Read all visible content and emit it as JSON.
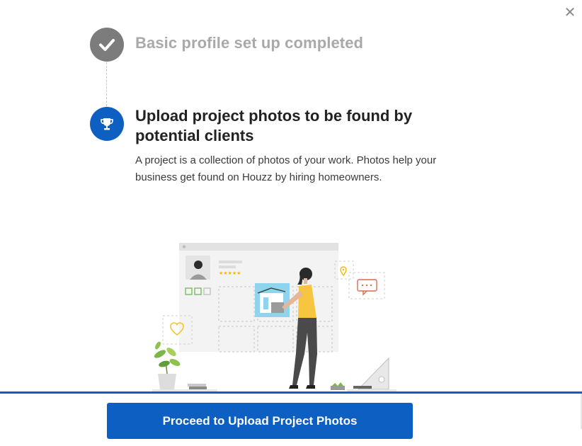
{
  "dialog": {
    "close_icon": "close-icon",
    "steps": [
      {
        "title": "Basic profile set up completed",
        "status": "completed",
        "icon": "checkmark-icon"
      },
      {
        "title": "Upload project photos to be found by potential clients",
        "description": "A project is a collection of photos of your work. Photos help your business get found on Houzz by hiring homeowners.",
        "status": "current",
        "icon": "trophy-icon"
      }
    ],
    "cta_label": "Proceed to Upload Project Photos"
  },
  "colors": {
    "accent": "#0e5fc2",
    "completed_gray": "#7c7c7c",
    "completed_text": "#a9a9a9"
  }
}
